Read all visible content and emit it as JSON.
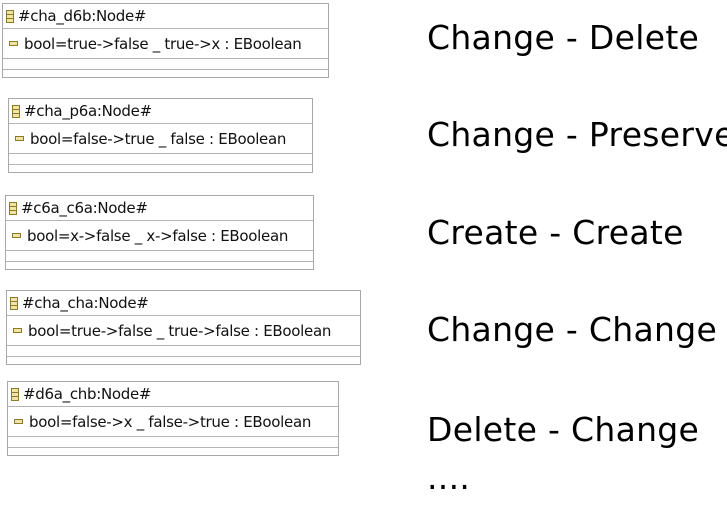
{
  "nodes": [
    {
      "title": "#cha_d6b:Node#",
      "attribute": "bool=true->false _ true->x : EBoolean"
    },
    {
      "title": "#cha_p6a:Node#",
      "attribute": "bool=false->true _ false : EBoolean"
    },
    {
      "title": "#c6a_c6a:Node#",
      "attribute": "bool=x->false _ x->false : EBoolean"
    },
    {
      "title": "#cha_cha:Node#",
      "attribute": "bool=true->false _ true->false : EBoolean"
    },
    {
      "title": "#d6a_chb:Node#",
      "attribute": "bool=false->x _ false->true : EBoolean"
    }
  ],
  "labels": [
    "Change - Delete",
    "Change - Preserve",
    "Create - Create",
    "Change - Change",
    "Delete - Change",
    "...."
  ]
}
